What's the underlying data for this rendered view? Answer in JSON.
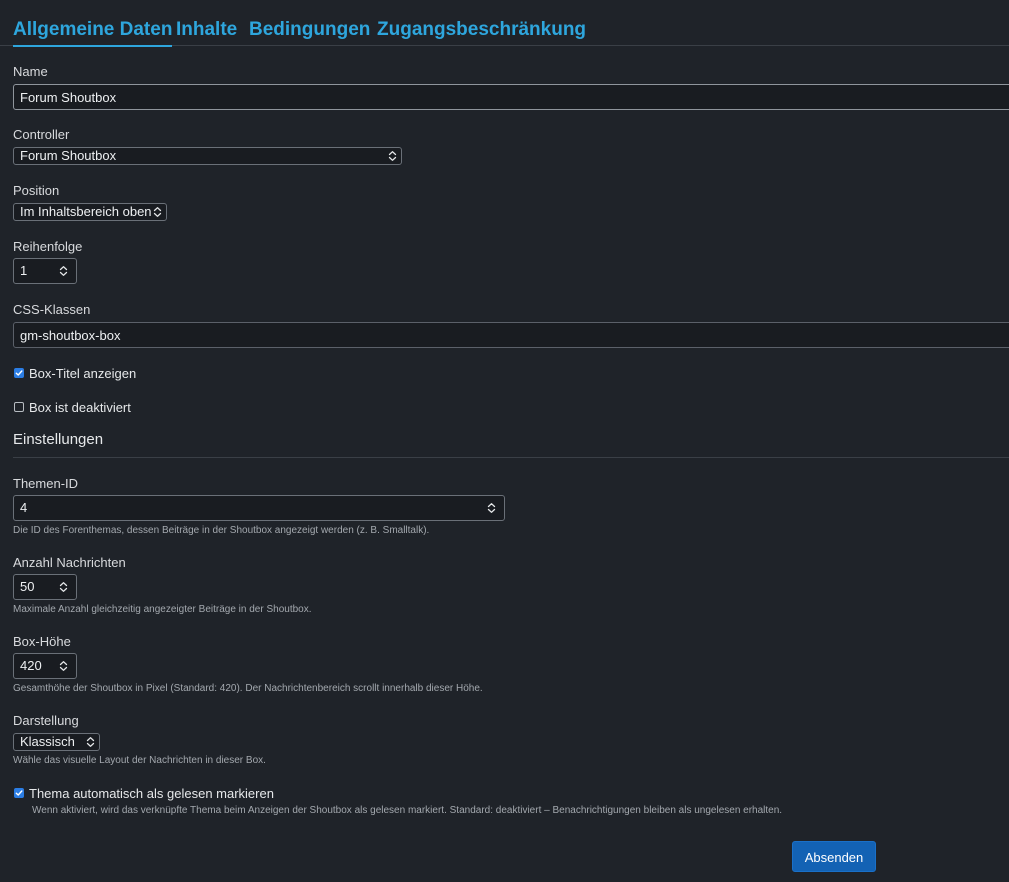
{
  "tabs": [
    {
      "label": "Allgemeine Daten",
      "active": true
    },
    {
      "label": "Inhalte"
    },
    {
      "label": "Bedingungen"
    },
    {
      "label": "Zugangsbeschränkung"
    }
  ],
  "fields": {
    "name": {
      "label": "Name",
      "value": "Forum Shoutbox"
    },
    "controller": {
      "label": "Controller",
      "value": "Forum Shoutbox"
    },
    "position": {
      "label": "Position",
      "value": "Im Inhaltsbereich oben"
    },
    "order": {
      "label": "Reihenfolge",
      "value": "1"
    },
    "css": {
      "label": "CSS-Klassen",
      "value": "gm-shoutbox-box"
    },
    "show_title": {
      "label": "Box-Titel anzeigen",
      "checked": true
    },
    "disabled": {
      "label": "Box ist deaktiviert",
      "checked": false
    }
  },
  "settings": {
    "title": "Einstellungen",
    "topic_id": {
      "label": "Themen-ID",
      "value": "4",
      "help": "Die ID des Forenthemas, dessen Beiträge in der Shoutbox angezeigt werden (z. B. Smalltalk)."
    },
    "message_count": {
      "label": "Anzahl Nachrichten",
      "value": "50",
      "help": "Maximale Anzahl gleichzeitig angezeigter Beiträge in der Shoutbox."
    },
    "box_height": {
      "label": "Box-Höhe",
      "value": "420",
      "help": "Gesamthöhe der Shoutbox in Pixel (Standard: 420). Der Nachrichtenbereich scrollt innerhalb dieser Höhe."
    },
    "display": {
      "label": "Darstellung",
      "value": "Klassisch",
      "help": "Wähle das visuelle Layout der Nachrichten in dieser Box."
    },
    "auto_read": {
      "label": "Thema automatisch als gelesen markieren",
      "checked": true,
      "help": "Wenn aktiviert, wird das verknüpfte Thema beim Anzeigen der Shoutbox als gelesen markiert. Standard: deaktiviert – Benachrichtigungen bleiben als ungelesen erhalten."
    }
  },
  "submit_label": "Absenden",
  "icons": {
    "select_chevron": "chevron-up-down-icon",
    "checkmark": "checkmark-icon"
  },
  "colors": {
    "background": "#1f2329",
    "accent": "#2ea6dd",
    "primary_button": "#1362b4",
    "checkbox_checked": "#2b7de4"
  }
}
